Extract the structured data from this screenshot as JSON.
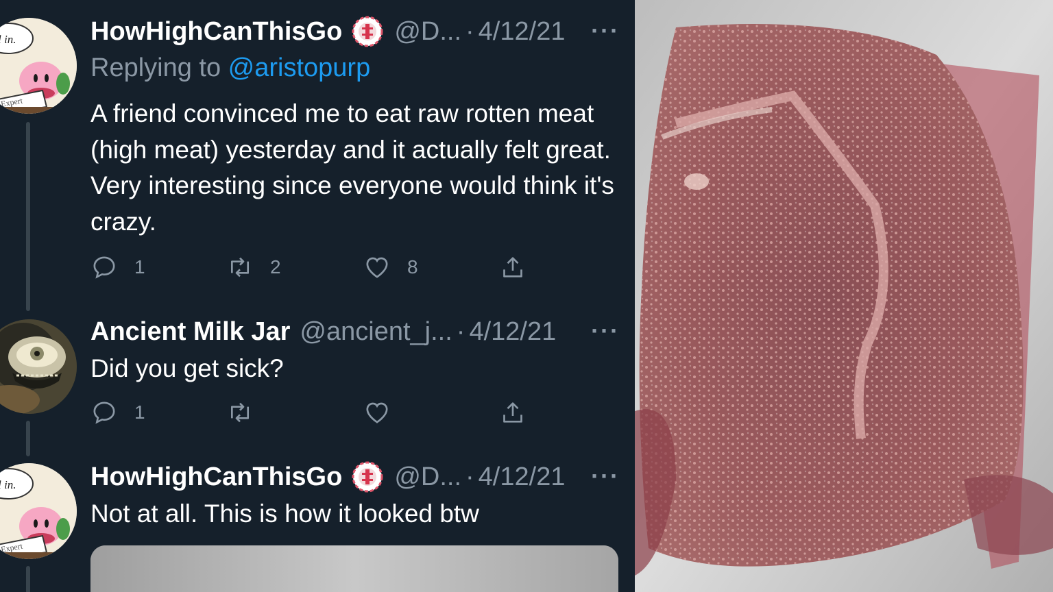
{
  "tweets": [
    {
      "name": "HowHighCanThisGo",
      "handle": "@D...",
      "separator": "·",
      "date": "4/12/21",
      "more": "···",
      "replying_prefix": "Replying to ",
      "replying_to": "@aristopurp",
      "text": "A friend convinced me to eat raw rotten meat (high meat) yesterday and it actually felt great. Very interesting since everyone would think it's crazy.",
      "reply_count": "1",
      "retweet_count": "2",
      "like_count": "8",
      "avatar_bubble_text": "All in.",
      "avatar_sign_text": "Expert"
    },
    {
      "name": "Ancient Milk Jar",
      "handle": "@ancient_j...",
      "separator": "·",
      "date": "4/12/21",
      "more": "···",
      "text": "Did you get sick?",
      "reply_count": "1",
      "retweet_count": "",
      "like_count": ""
    },
    {
      "name": "HowHighCanThisGo",
      "handle": "@D...",
      "separator": "·",
      "date": "4/12/21",
      "more": "···",
      "text": "Not at all. This is how it looked btw",
      "avatar_bubble_text": "All in.",
      "avatar_sign_text": "Expert"
    }
  ],
  "icons": {
    "reply": "reply-icon",
    "retweet": "retweet-icon",
    "like": "heart-icon",
    "share": "share-icon",
    "verified": "badge-icon"
  },
  "colors": {
    "background": "#15202b",
    "text": "#ffffff",
    "secondary": "#8b98a5",
    "link": "#1d9bf0",
    "thread_line": "#38444d"
  }
}
